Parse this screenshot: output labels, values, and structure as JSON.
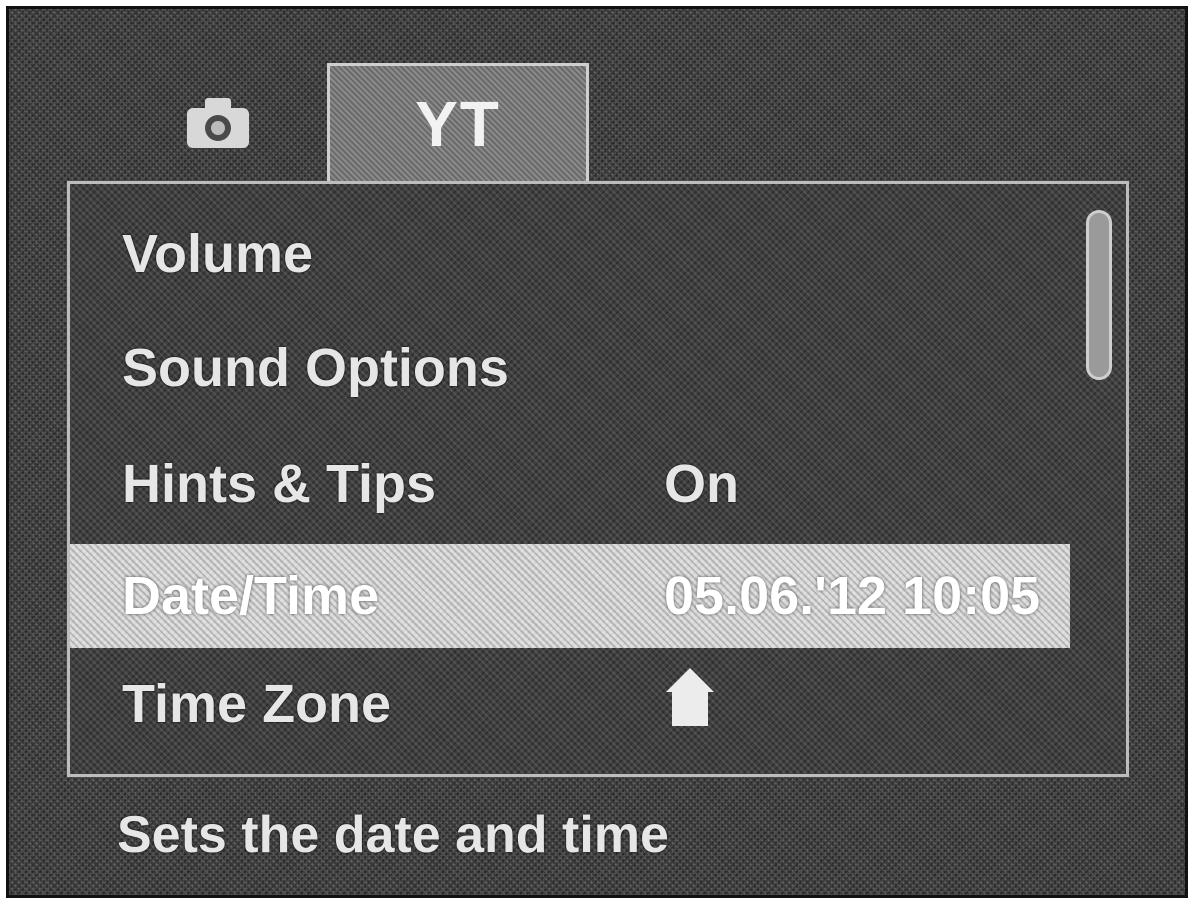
{
  "tabs": [
    {
      "icon": "camera-icon",
      "glyph": "",
      "selected": false
    },
    {
      "icon": "setup-tools-icon",
      "glyph": "YT",
      "selected": true
    }
  ],
  "menu": {
    "items": [
      {
        "label": "Volume",
        "value": ""
      },
      {
        "label": "Sound Options",
        "value": ""
      },
      {
        "label": "Hints & Tips",
        "value": "On"
      },
      {
        "label": "Date/Time",
        "value": "05.06.'12 10:05",
        "selected": true
      },
      {
        "label": "Time Zone",
        "value": "",
        "value_icon": "home-icon"
      }
    ]
  },
  "hint": "Sets the date and time",
  "colors": {
    "background": "#3a3a3a",
    "selected_row": "#d9d9d9",
    "text": "#e6e6e6",
    "border": "#bdbdbd"
  }
}
